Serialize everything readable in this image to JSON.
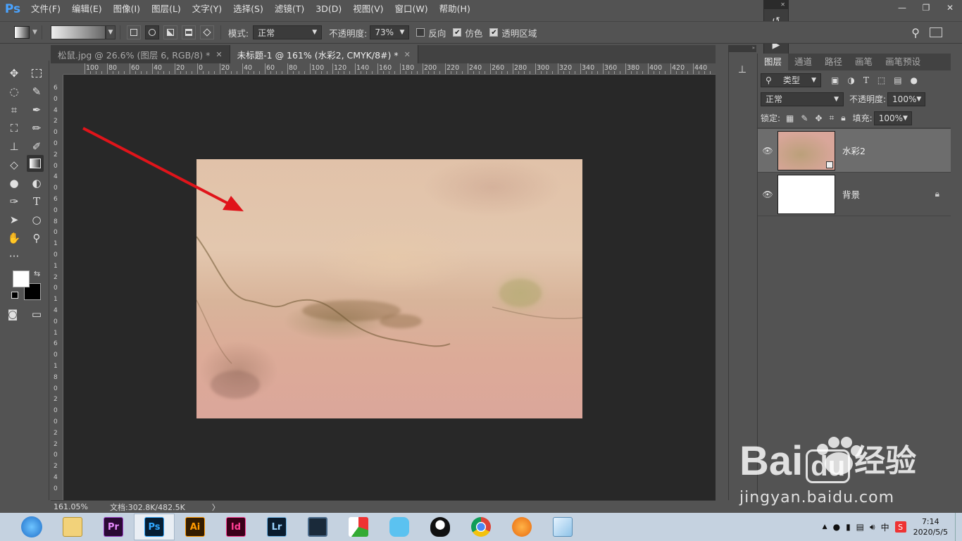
{
  "menu": {
    "logo": "Ps",
    "items": [
      "文件(F)",
      "编辑(E)",
      "图像(I)",
      "图层(L)",
      "文字(Y)",
      "选择(S)",
      "滤镜(T)",
      "3D(D)",
      "视图(V)",
      "窗口(W)",
      "帮助(H)"
    ]
  },
  "window_controls": {
    "minimize": "—",
    "restore": "❐",
    "close": "✕"
  },
  "options": {
    "mode_label": "模式:",
    "mode_value": "正常",
    "opacity_label": "不透明度:",
    "opacity_value": "73%",
    "reverse_label": "反向",
    "dither_label": "仿色",
    "transparency_label": "透明区域"
  },
  "tabs": [
    {
      "label": "松鼠.jpg @ 26.6% (图层 6, RGB/8) *",
      "close": "✕"
    },
    {
      "label": "未标题-1 @ 161% (水彩2, CMYK/8#) *",
      "close": "✕"
    }
  ],
  "ruler_top": [
    "100",
    "80",
    "60",
    "40",
    "20",
    "0",
    "20",
    "40",
    "60",
    "80",
    "100",
    "120",
    "140",
    "160",
    "180",
    "200",
    "220",
    "240",
    "260",
    "280",
    "300",
    "320",
    "340",
    "360",
    "380",
    "400",
    "420",
    "440"
  ],
  "ruler_left": [
    "6",
    "0",
    "4",
    "2",
    "0",
    "0",
    "2",
    "0",
    "4",
    "0",
    "6",
    "0",
    "8",
    "0",
    "1",
    "0",
    "1",
    "2",
    "0",
    "1",
    "4",
    "0",
    "1",
    "6",
    "0",
    "1",
    "8",
    "0",
    "2",
    "0",
    "0",
    "2",
    "2",
    "0",
    "2",
    "4",
    "0"
  ],
  "panel": {
    "tabs": [
      "图层",
      "通道",
      "路径",
      "画笔",
      "画笔预设"
    ],
    "filter_label": "类型",
    "blend_mode": "正常",
    "opacity_label": "不透明度:",
    "opacity_value": "100%",
    "lock_label": "锁定:",
    "fill_label": "填充:",
    "fill_value": "100%",
    "layers": [
      {
        "name": "水彩2",
        "selected": true
      },
      {
        "name": "背景",
        "locked": true
      }
    ]
  },
  "status": {
    "zoom": "161.05%",
    "doc_info": "文档:302.8K/482.5K",
    "arrow": "〉"
  },
  "taskbar": {
    "apps": [
      "Pr",
      "Ps",
      "Ai",
      "Id",
      "Lr"
    ],
    "ime": "中",
    "time": "7:14",
    "date": "2020/5/5"
  },
  "watermark": {
    "brand": "Bai",
    "brand2": "du",
    "cn": "经验",
    "url": "jingyan.baidu.com"
  },
  "colors": {
    "accent": "#31a8ff",
    "ui_dark": "#535353",
    "pasteboard": "#282828",
    "arrow": "#e0141a"
  }
}
